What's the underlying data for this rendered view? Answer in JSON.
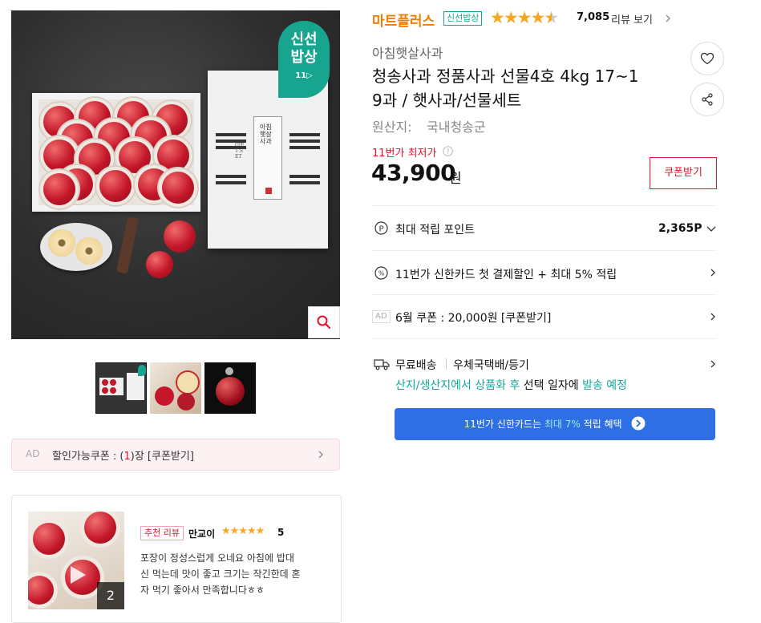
{
  "header": {
    "store_badge": "마트플러스",
    "fresh_tag": "신선밥상",
    "rating": 4.6,
    "review_count": "7,085",
    "review_link": "리뷰 보기"
  },
  "product": {
    "seller": "아침햇살사과",
    "title_line1": "청송사과 정품사과 선물4호 4kg 17~1",
    "title_line2": "9과 / 햇사과/선물세트",
    "origin_label": "원산지:",
    "origin_value": "국내청송군",
    "lowest_label": "11번가 최저가",
    "price": "43,900",
    "price_unit": "원",
    "coupon_button": "쿠폰받기"
  },
  "image_badge": {
    "line1": "신선",
    "line2": "밥상",
    "line3": "11▷"
  },
  "gift_box": {
    "brand": "아침햇살사과",
    "label": "GIFT SET"
  },
  "benefits": {
    "points_label": "최대 적립 포인트",
    "points_value": "2,365P",
    "card_label": "11번가 신한카드 첫 결제할인 + 최대 5% 적립",
    "ad_tag": "AD",
    "ad_coupon_label": "6월 쿠폰 : 20,000원 [쿠폰받기]",
    "shipping_free": "무료배송",
    "shipping_method": "우체국택배/등기",
    "shipping_note_part1": "산지/생산지에서 상품화 후",
    "shipping_note_part2": " 선택 일자에 ",
    "shipping_note_part3": "발송 예정",
    "promo_button_part1": "11번가 신한카드는 ",
    "promo_button_part2": "최대 7%",
    "promo_button_part3": " 적립 혜택"
  },
  "coupon_strip": {
    "ad_tag": "AD",
    "text_prefix": "할인가능쿠폰 : (",
    "count": "1",
    "text_suffix": ")장 [쿠폰받기]"
  },
  "review": {
    "badge": "추천 리뷰",
    "author": "만교이",
    "score": "5",
    "text_line1": "포장이 정성스럽게 오네요 아침에 밥대",
    "text_line2": "신 먹는데 맛이 좋고 크기는 작긴한데 혼",
    "text_line3": "자 먹기 좋아서 만족합니다ㅎㅎ",
    "media_count": "2"
  },
  "colors": {
    "brand_orange": "#f57c00",
    "teal": "#17a58f",
    "red": "#e2122b",
    "blue": "#2f6fe4",
    "link_teal": "#14a79b"
  },
  "icons": [
    "heart-icon",
    "share-icon",
    "search-icon",
    "point-icon",
    "percent-icon",
    "truck-icon",
    "chevron-right-icon",
    "chevron-down-icon",
    "play-icon",
    "question-icon"
  ]
}
